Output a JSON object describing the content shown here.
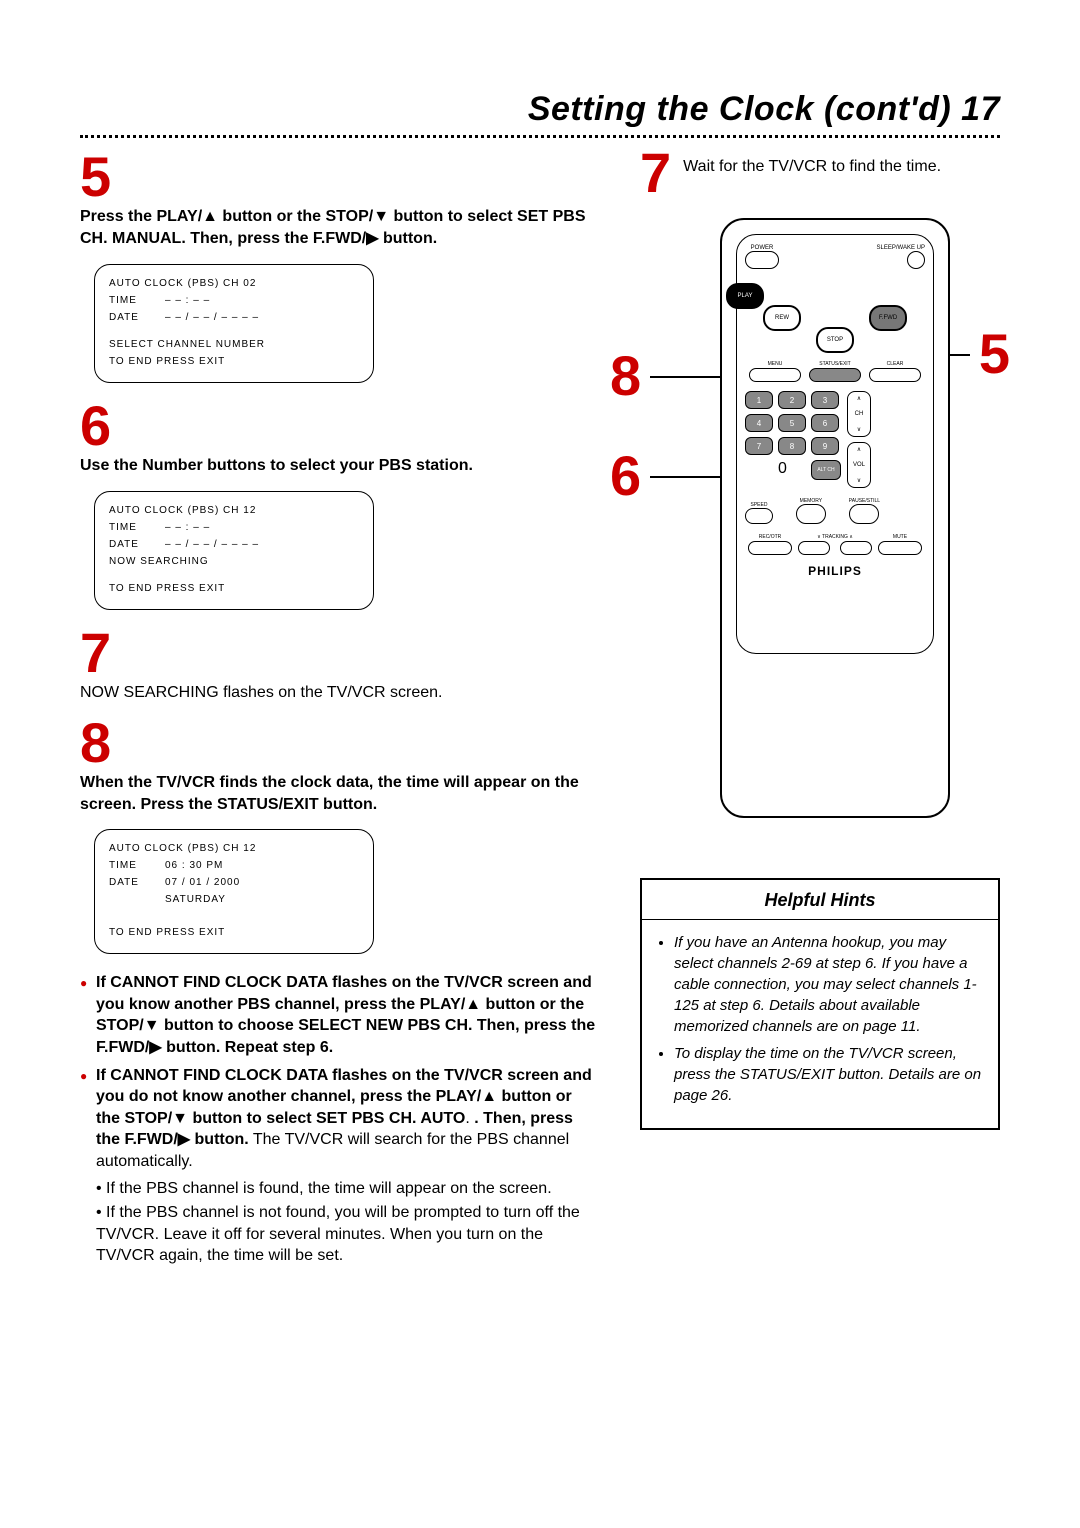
{
  "header": {
    "title": "Setting the Clock (cont'd)  17"
  },
  "steps": {
    "s5": {
      "num": "5",
      "text_before": "Press the PLAY/▲ button or the STOP/▼ button to select SET PBS CH. MANUAL. Then, press the F.FWD/▶ button."
    },
    "osd1": {
      "header": "AUTO CLOCK (PBS) CH 02",
      "time_label": "TIME",
      "time_val": "– – : – –",
      "date_label": "DATE",
      "date_val": "– – / – – / – – – –",
      "line1": "SELECT CHANNEL NUMBER",
      "line2": "TO END PRESS EXIT"
    },
    "s6": {
      "num": "6",
      "text": "Use the Number buttons to select your PBS station."
    },
    "osd2": {
      "header": "AUTO CLOCK (PBS) CH 12",
      "time_label": "TIME",
      "time_val": "– – : – –",
      "date_label": "DATE",
      "date_val": "– – / – – / – – – –",
      "line1": "NOW SEARCHING",
      "line2": "TO END PRESS EXIT"
    },
    "s7": {
      "num": "7",
      "text": "NOW SEARCHING flashes on the TV/VCR screen."
    },
    "s8": {
      "num": "8",
      "text": "When the TV/VCR finds the clock data, the time will appear on the screen. Press the STATUS/EXIT button."
    },
    "osd3": {
      "header": "AUTO CLOCK (PBS) CH 12",
      "time_label": "TIME",
      "time_val": "06 : 30 PM",
      "date_label": "DATE",
      "date_val": "07 / 01 / 2000",
      "date_day": "SATURDAY",
      "line2": "TO END PRESS EXIT"
    },
    "bullets": {
      "b1": "If CANNOT FIND CLOCK DATA flashes on the TV/VCR screen and you know another PBS channel, press the PLAY/▲ button or the STOP/▼ button to choose SELECT NEW PBS CH. Then, press the F.FWD/▶ button. Repeat step 6.",
      "b2_bold": "If CANNOT FIND CLOCK DATA flashes on the TV/VCR screen and you do not know another channel, press the PLAY/▲ button or the STOP/▼ button to select SET PBS CH. AUTO",
      "b2_mid": ". Then, press the F.FWD/▶ button.",
      "b2_tail": " The TV/VCR will search for the PBS channel automatically.",
      "sub1": "• If the PBS channel is found, the time will appear on the screen.",
      "sub2": "• If the PBS channel is not found, you will be prompted to turn off the TV/VCR. Leave it off for several minutes. When you turn on the TV/VCR again, the time will be set."
    }
  },
  "right": {
    "s7num": "7",
    "s7text": "Wait for the TV/VCR to find the time.",
    "callouts": {
      "c8": "8",
      "c6": "6",
      "c5": "5"
    }
  },
  "remote": {
    "power_label": "POWER",
    "sleep_label": "SLEEP/WAKE UP",
    "play": "PLAY",
    "rew": "REW",
    "ffwd": "F.FWD",
    "stop": "STOP",
    "menu": "MENU",
    "status": "STATUS/EXIT",
    "clear": "CLEAR",
    "keys": [
      "1",
      "2",
      "3",
      "4",
      "5",
      "6",
      "7",
      "8",
      "9",
      "0"
    ],
    "altch": "ALT CH",
    "ch": "CH",
    "vol": "VOL",
    "speed": "SPEED",
    "memory": "MEMORY",
    "pause": "PAUSE/STILL",
    "recotr": "REC/OTR",
    "tracking": "∨ TRACKING ∧",
    "mute": "MUTE",
    "brand": "PHILIPS"
  },
  "hints": {
    "title": "Helpful Hints",
    "items": [
      "If you have an Antenna hookup, you may select channels 2-69 at step 6. If you have a cable connection, you may select channels 1-125 at step 6. Details about available memorized channels are on page 11.",
      "To display the time on the TV/VCR screen, press the STATUS/EXIT button. Details are on page 26."
    ]
  }
}
